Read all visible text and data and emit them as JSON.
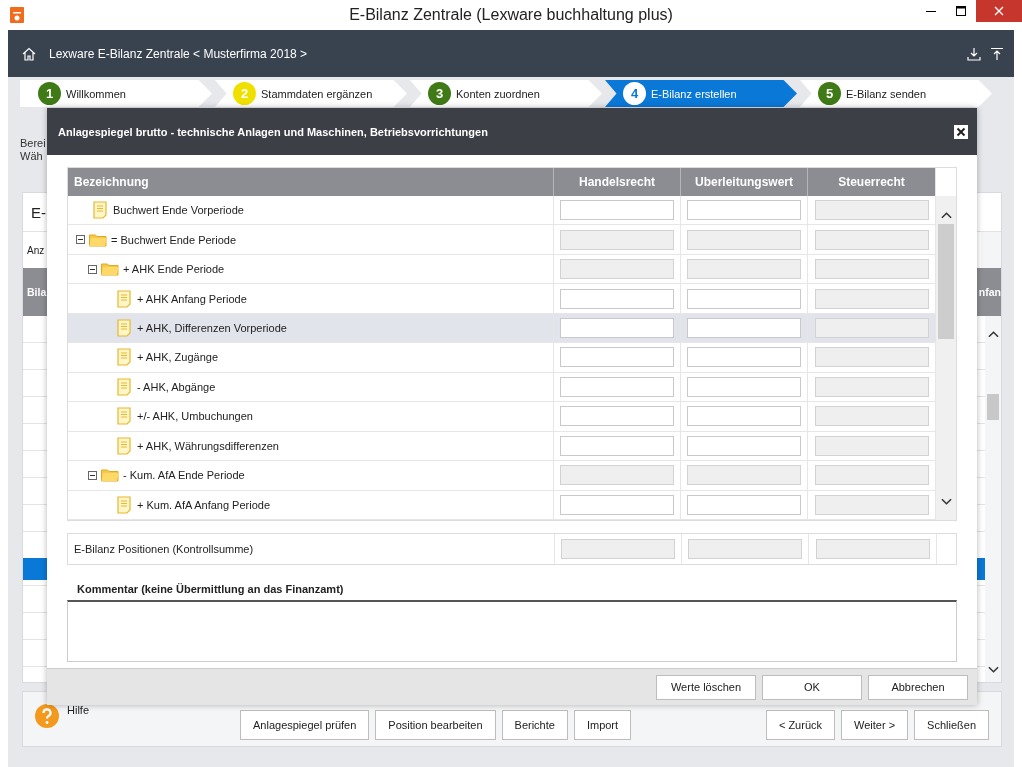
{
  "window": {
    "title": "E-Bilanz Zentrale (Lexware buchhaltung plus)"
  },
  "breadcrumb": "Lexware E-Bilanz Zentrale < Musterfirma 2018 >",
  "steps": [
    {
      "number": "1",
      "label": "Willkommen",
      "selected": false,
      "color": "#3f7a17"
    },
    {
      "number": "2",
      "label": "Stammdaten ergänzen",
      "selected": false,
      "color": "#f0e000"
    },
    {
      "number": "3",
      "label": "Konten zuordnen",
      "selected": false,
      "color": "#3f7a17"
    },
    {
      "number": "4",
      "label": "E-Bilanz erstellen",
      "selected": true,
      "color": "#ffffff"
    },
    {
      "number": "5",
      "label": "E-Bilanz senden",
      "selected": false,
      "color": "#3f7a17"
    }
  ],
  "intro_lines": [
    "Berei",
    "Wäh"
  ],
  "card": {
    "title": "E-",
    "subtitle": "Anz",
    "header_left": "Bila",
    "header_right": "nfan"
  },
  "dialog": {
    "title": "Anlagespiegel brutto - technische Anlagen und Maschinen, Betriebsvorrichtungen",
    "columns": [
      "Bezeichnung",
      "Handelsrecht",
      "Uberleitungswert",
      "Steuerrecht"
    ],
    "rows": [
      {
        "label": "Buchwert Ende Vorperiode",
        "kind": "document",
        "selected": false,
        "fields": [
          {
            "disabled": false
          },
          {
            "disabled": false
          },
          {
            "disabled": true
          }
        ]
      },
      {
        "label": "= Buchwert Ende Periode",
        "kind": "folder",
        "expanded": true,
        "selected": false,
        "fields": [
          {
            "disabled": true
          },
          {
            "disabled": true
          },
          {
            "disabled": true
          }
        ],
        "children": [
          {
            "label": "+ AHK Ende Periode",
            "kind": "folder",
            "expanded": true,
            "selected": false,
            "fields": [
              {
                "disabled": true
              },
              {
                "disabled": true
              },
              {
                "disabled": true
              }
            ],
            "children": [
              {
                "label": "+ AHK Anfang Periode",
                "kind": "document",
                "selected": false,
                "fields": [
                  {
                    "disabled": false
                  },
                  {
                    "disabled": false
                  },
                  {
                    "disabled": true
                  }
                ]
              },
              {
                "label": "+ AHK, Differenzen Vorperiode",
                "kind": "document",
                "selected": true,
                "fields": [
                  {
                    "disabled": false
                  },
                  {
                    "disabled": false
                  },
                  {
                    "disabled": true
                  }
                ]
              },
              {
                "label": "+ AHK, Zugänge",
                "kind": "document",
                "selected": false,
                "fields": [
                  {
                    "disabled": false
                  },
                  {
                    "disabled": false
                  },
                  {
                    "disabled": true
                  }
                ]
              },
              {
                "label": "- AHK, Abgänge",
                "kind": "document",
                "selected": false,
                "fields": [
                  {
                    "disabled": false
                  },
                  {
                    "disabled": false
                  },
                  {
                    "disabled": true
                  }
                ]
              },
              {
                "label": "+/- AHK, Umbuchungen",
                "kind": "document",
                "selected": false,
                "fields": [
                  {
                    "disabled": false
                  },
                  {
                    "disabled": false
                  },
                  {
                    "disabled": true
                  }
                ]
              },
              {
                "label": "+ AHK, Währungsdifferenzen",
                "kind": "document",
                "selected": false,
                "fields": [
                  {
                    "disabled": false
                  },
                  {
                    "disabled": false
                  },
                  {
                    "disabled": true
                  }
                ]
              }
            ]
          },
          {
            "label": "- Kum. AfA Ende Periode",
            "kind": "folder",
            "expanded": true,
            "selected": false,
            "fields": [
              {
                "disabled": true
              },
              {
                "disabled": true
              },
              {
                "disabled": true
              }
            ],
            "children": [
              {
                "label": "+ Kum. AfA Anfang Periode",
                "kind": "document",
                "selected": false,
                "fields": [
                  {
                    "disabled": false
                  },
                  {
                    "disabled": false
                  },
                  {
                    "disabled": true
                  }
                ]
              }
            ]
          }
        ]
      }
    ],
    "checksum": {
      "label": "E-Bilanz Positionen (Kontrollsumme)",
      "fields": [
        {
          "disabled": true
        },
        {
          "disabled": true
        },
        {
          "disabled": true
        }
      ]
    },
    "comment": {
      "label": "Kommentar (keine Übermittlung an das Finanzamt)"
    },
    "buttons": [
      "Werte löschen",
      "OK",
      "Abbrechen"
    ]
  },
  "footer": {
    "help": "Hilfe",
    "buttons": [
      "Anlagespiegel prüfen",
      "Position bearbeiten",
      "Berichte",
      "Import"
    ],
    "nav_buttons": [
      "< Zurück",
      "Weiter >",
      "Schließen"
    ]
  }
}
